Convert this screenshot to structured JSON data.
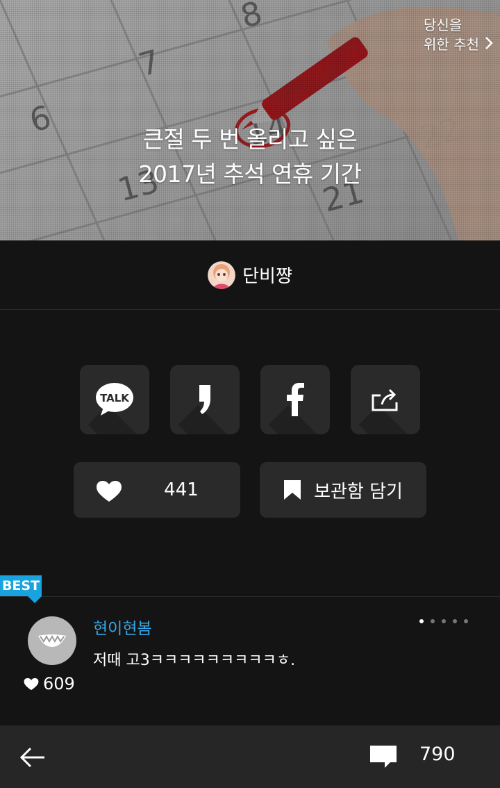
{
  "hero": {
    "title_line1": "큰절 두 번 올리고 싶은",
    "title_line2": "2017년 추석 연휴 기간",
    "recommend_line1": "당신을",
    "recommend_line2": "위한 추천"
  },
  "author": {
    "name": "단비쨩"
  },
  "share": {
    "icons": [
      "kakaotalk-icon",
      "kakaostory-icon",
      "facebook-icon",
      "share-icon"
    ],
    "talk_label": "TALK"
  },
  "actions": {
    "like_count": "441",
    "keep_label": "보관함 담기"
  },
  "best_comment": {
    "badge": "BEST",
    "user": "현이현봄",
    "text": "저때 고3ㅋㅋㅋㅋㅋㅋㅋㅋㅋㅎ.",
    "likes": "609",
    "page_count": 5,
    "active_page": 1
  },
  "bottom_bar": {
    "comment_count": "790"
  },
  "colors": {
    "accent": "#18a3de",
    "username": "#36a7e8",
    "background": "#141414",
    "button": "#2a2a2a"
  }
}
